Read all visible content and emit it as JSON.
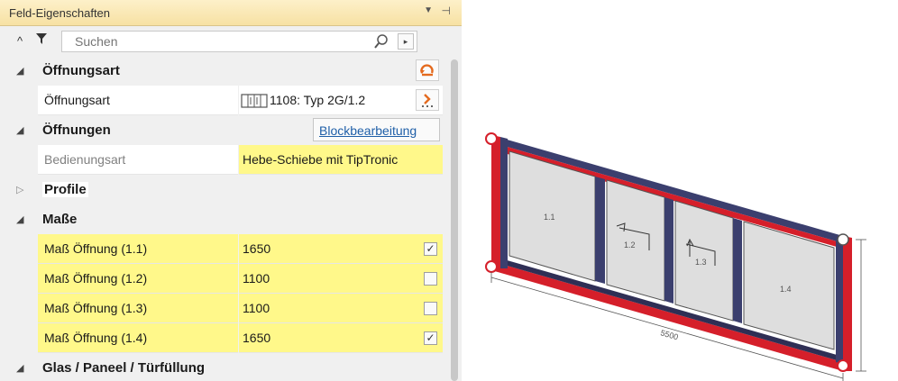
{
  "panel": {
    "title": "Feld-Eigenschaften",
    "search_placeholder": "Suchen",
    "categories": {
      "oeffnungsart": "Öffnungsart",
      "oeffnungen": "Öffnungen",
      "profile": "Profile",
      "masse": "Maße",
      "glas": "Glas / Paneel / Türfüllung"
    },
    "rows": {
      "oeffnungsart": {
        "name": "Öffnungsart",
        "value": "1108: Typ 2G/1.2"
      },
      "bedienungsart": {
        "name": "Bedienungsart",
        "value": "Hebe-Schiebe mit TipTronic"
      }
    },
    "block_edit_label": "Blockbearbeitung",
    "masse": [
      {
        "name": "Maß Öffnung (1.1)",
        "value": "1650",
        "checked": true
      },
      {
        "name": "Maß Öffnung (1.2)",
        "value": "1100",
        "checked": false
      },
      {
        "name": "Maß Öffnung (1.3)",
        "value": "1100",
        "checked": false
      },
      {
        "name": "Maß Öffnung (1.4)",
        "value": "1650",
        "checked": true
      }
    ]
  },
  "drawing": {
    "pane_labels": [
      "1.1",
      "1.2",
      "1.3",
      "1.4"
    ],
    "dimension_width": "5500",
    "colors": {
      "frame": "#d51f2a",
      "profile": "#3b3f6e",
      "glass": "#dedede"
    }
  }
}
